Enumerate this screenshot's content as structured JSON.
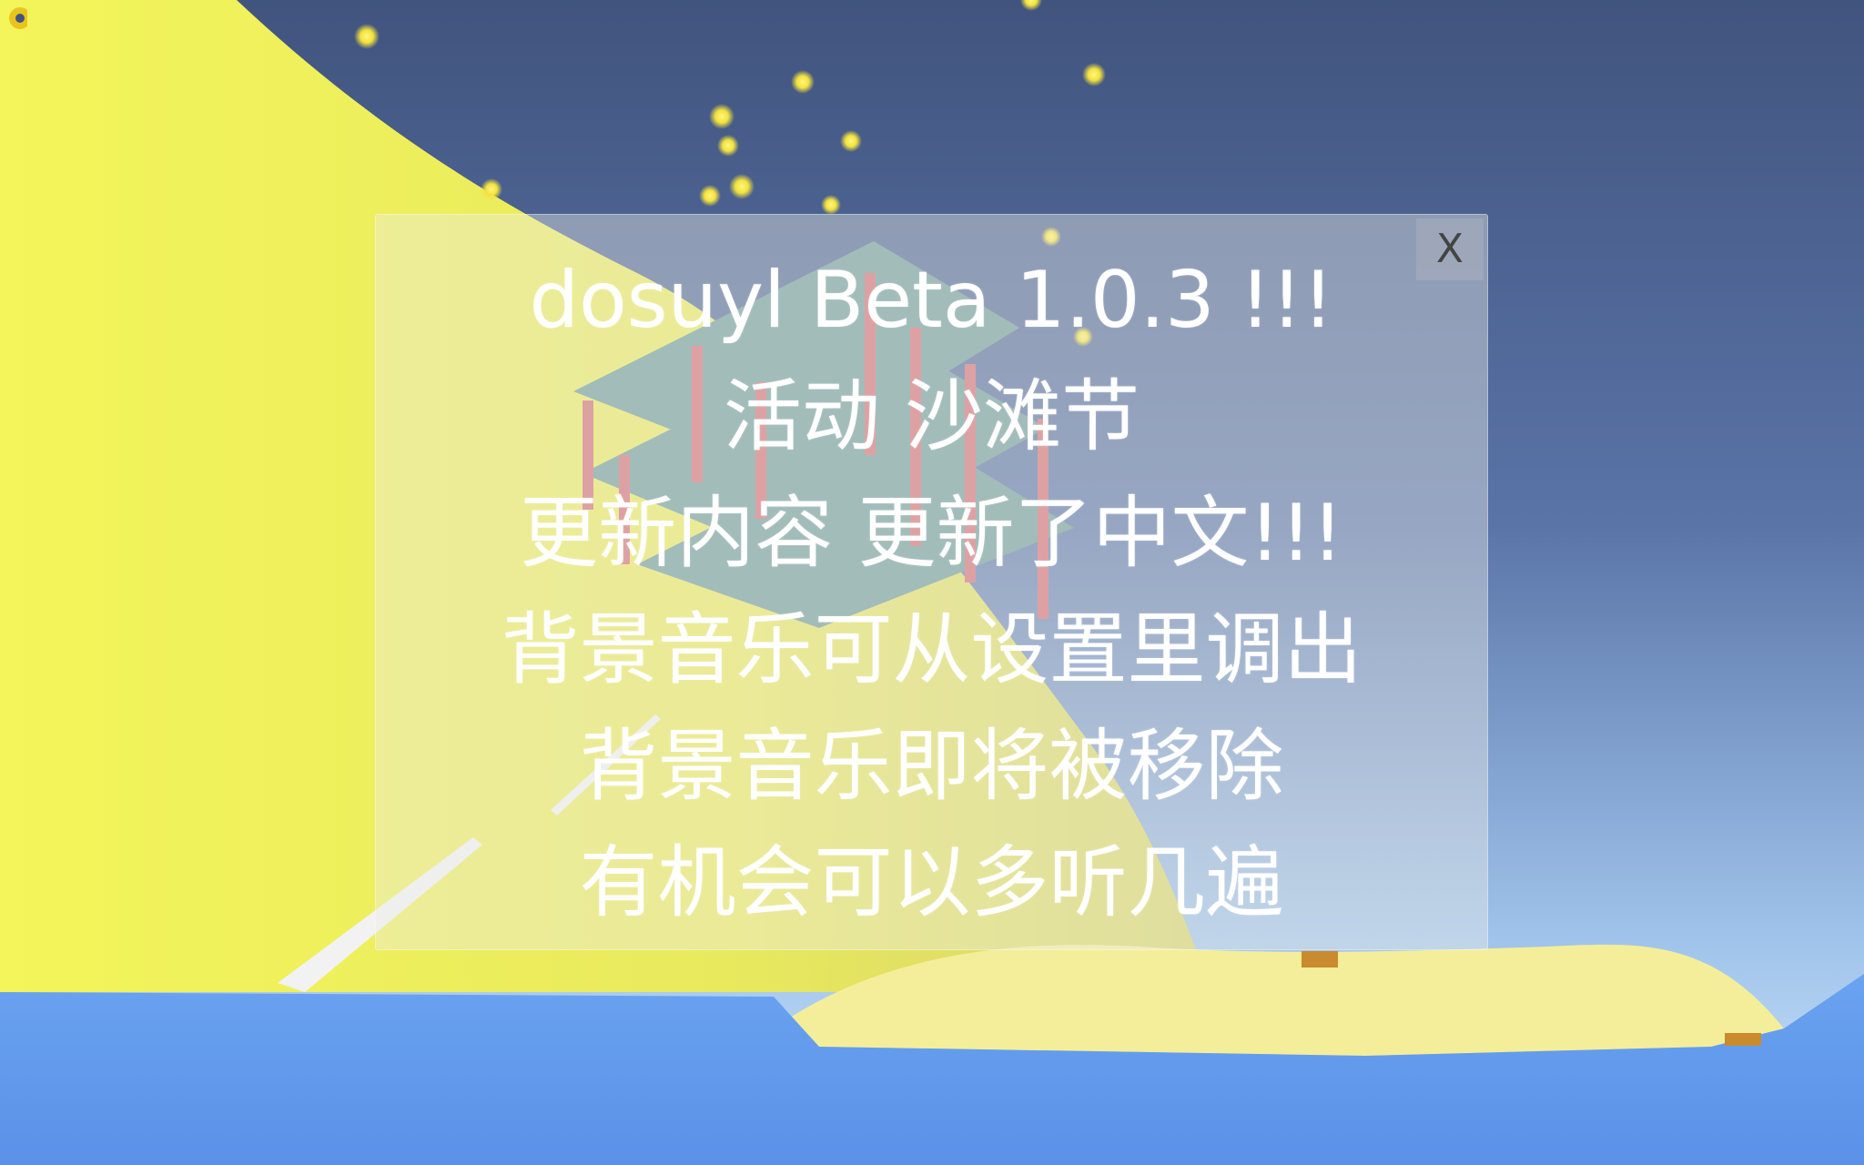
{
  "dialog": {
    "close_label": "X",
    "lines": [
      "dosuyl Beta 1.0.3 !!!",
      "活动 沙滩节",
      "更新内容 更新了中文!!!",
      "背景音乐可从设置里调出",
      "背景音乐即将被移除",
      "有机会可以多听几遍"
    ]
  },
  "icons": {
    "settings": "gear-icon"
  },
  "colors": {
    "sky": "#4a5f8f",
    "sand": "#f2f08a",
    "water": "#6fa8f5",
    "sparkle": "#ffe94a"
  }
}
